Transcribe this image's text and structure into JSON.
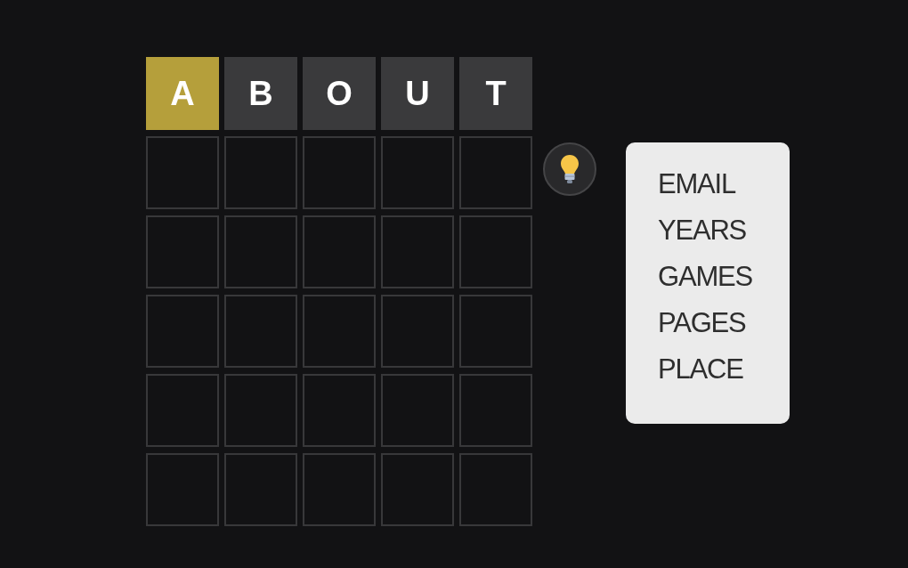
{
  "board": {
    "rows": [
      {
        "tiles": [
          {
            "letter": "A",
            "kind": "present"
          },
          {
            "letter": "B",
            "kind": "absent"
          },
          {
            "letter": "O",
            "kind": "absent"
          },
          {
            "letter": "U",
            "kind": "absent"
          },
          {
            "letter": "T",
            "kind": "absent"
          }
        ]
      },
      {
        "tiles": [
          {
            "kind": "empty"
          },
          {
            "kind": "empty"
          },
          {
            "kind": "empty"
          },
          {
            "kind": "empty"
          },
          {
            "kind": "empty"
          }
        ]
      },
      {
        "tiles": [
          {
            "kind": "empty"
          },
          {
            "kind": "empty"
          },
          {
            "kind": "empty"
          },
          {
            "kind": "empty"
          },
          {
            "kind": "empty"
          }
        ]
      },
      {
        "tiles": [
          {
            "kind": "empty"
          },
          {
            "kind": "empty"
          },
          {
            "kind": "empty"
          },
          {
            "kind": "empty"
          },
          {
            "kind": "empty"
          }
        ]
      },
      {
        "tiles": [
          {
            "kind": "empty"
          },
          {
            "kind": "empty"
          },
          {
            "kind": "empty"
          },
          {
            "kind": "empty"
          },
          {
            "kind": "empty"
          }
        ]
      },
      {
        "tiles": [
          {
            "kind": "empty"
          },
          {
            "kind": "empty"
          },
          {
            "kind": "empty"
          },
          {
            "kind": "empty"
          },
          {
            "kind": "empty"
          }
        ]
      }
    ]
  },
  "hint_panel": {
    "words": [
      "EMAIL",
      "YEARS",
      "GAMES",
      "PAGES",
      "PLACE"
    ]
  }
}
